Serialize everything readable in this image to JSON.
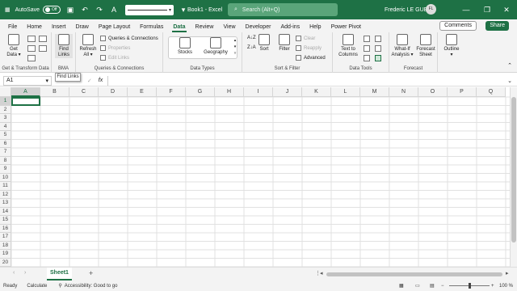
{
  "titlebar": {
    "autosave": "AutoSave",
    "autosave_state": "Off",
    "doc_title": "Book1 - Excel",
    "search_placeholder": "Search (Alt+Q)",
    "user_name": "Frederic LE GUEN",
    "user_initials": "FL",
    "minimize": "—",
    "restore": "❐",
    "close": "✕"
  },
  "tabs": [
    "File",
    "Home",
    "Insert",
    "Draw",
    "Page Layout",
    "Formulas",
    "Data",
    "Review",
    "View",
    "Developer",
    "Add-ins",
    "Help",
    "Power Pivot"
  ],
  "active_tab": "Data",
  "actions": {
    "comments": "Comments",
    "share": "Share"
  },
  "ribbon": {
    "get_data_1": "Get",
    "get_data_2": "Data ▾",
    "group_get_transform": "Get & Transform Data",
    "find_links_1": "Find",
    "find_links_2": "Links",
    "group_bma": "BMA",
    "refresh_all_1": "Refresh",
    "refresh_all_2": "All ▾",
    "queries_connections": "Queries & Connections",
    "properties": "Properties",
    "edit_links": "Edit Links",
    "group_queries": "Queries & Connections",
    "stocks": "Stocks",
    "geography": "Geography",
    "group_data_types": "Data Types",
    "sort_az": "A↓Z",
    "sort_za": "Z↓A",
    "sort": "Sort",
    "filter": "Filter",
    "clear": "Clear",
    "reapply": "Reapply",
    "advanced": "Advanced",
    "group_sort_filter": "Sort & Filter",
    "text_to_columns_1": "Text to",
    "text_to_columns_2": "Columns",
    "group_data_tools": "Data Tools",
    "what_if_1": "What-If",
    "what_if_2": "Analysis ▾",
    "forecast_sheet_1": "Forecast",
    "forecast_sheet_2": "Sheet",
    "group_forecast": "Forecast",
    "outline": "Outline"
  },
  "tooltip": "Find Links",
  "formula_bar": {
    "name_box": "A1",
    "fx": "fx",
    "cancel": "✕",
    "enter": "✓"
  },
  "columns": [
    "A",
    "B",
    "C",
    "D",
    "E",
    "F",
    "G",
    "H",
    "I",
    "J",
    "K",
    "L",
    "M",
    "N",
    "O",
    "P",
    "Q"
  ],
  "rows": [
    "1",
    "2",
    "3",
    "4",
    "5",
    "6",
    "7",
    "8",
    "9",
    "10",
    "11",
    "12",
    "13",
    "14",
    "15",
    "16",
    "17",
    "18",
    "19",
    "20"
  ],
  "sheets": {
    "active": "Sheet1",
    "add": "+"
  },
  "status": {
    "ready": "Ready",
    "calculate": "Calculate",
    "accessibility": "Accessibility: Good to go",
    "zoom": "100 %"
  }
}
